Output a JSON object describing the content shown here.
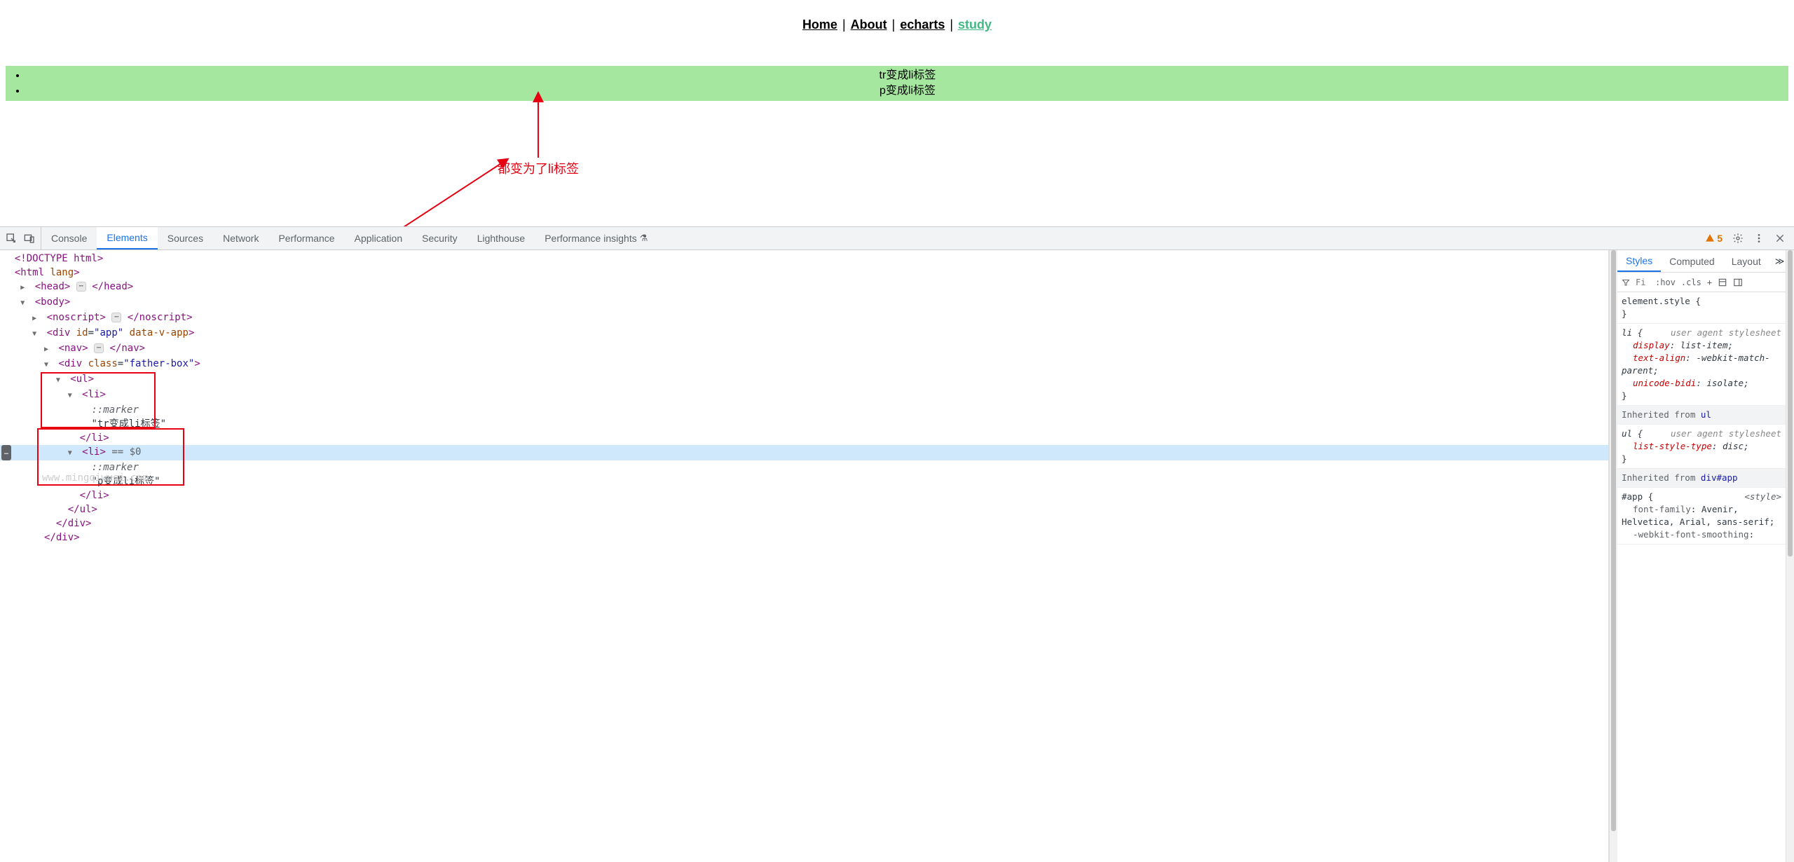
{
  "nav": {
    "items": [
      {
        "label": "Home",
        "active": false
      },
      {
        "label": "About",
        "active": false
      },
      {
        "label": "echarts",
        "active": false
      },
      {
        "label": "study",
        "active": true
      }
    ],
    "sep": " | "
  },
  "list": {
    "items": [
      "tr变成li标签",
      "p变成li标签"
    ]
  },
  "annotation": {
    "text": "都变为了li标签"
  },
  "devtools": {
    "tabs": [
      "Console",
      "Elements",
      "Sources",
      "Network",
      "Performance",
      "Application",
      "Security",
      "Lighthouse",
      "Performance insights"
    ],
    "active_tab": "Elements",
    "experiment_suffix_on": "Performance insights",
    "warn_count": "5",
    "elements": {
      "doctype": "<!DOCTYPE html>",
      "html_open": "<html lang>",
      "head": {
        "open": "<head>",
        "close": "</head>"
      },
      "body_open": "<body>",
      "noscript": {
        "open": "<noscript>",
        "close": "</noscript>"
      },
      "app_div": "<div id=\"app\" data-v-app>",
      "nav": {
        "open": "<nav>",
        "close": "</nav>"
      },
      "father_box": "<div class=\"father-box\">",
      "ul_open": "<ul>",
      "li1_open": "<li>",
      "li1_marker": "::marker",
      "li1_text": "\"tr变成li标签\"",
      "li1_close": "</li>",
      "li2_open": "<li>",
      "li2_selected": "== $0",
      "li2_marker": "::marker",
      "li2_text": "\"p变成li标签\"",
      "li2_close": "</li>",
      "ul_close": "</ul>",
      "div_close1": "</div>",
      "div_close2": "</div>",
      "selected_badge": "…"
    },
    "styles": {
      "tabs": [
        "Styles",
        "Computed",
        "Layout"
      ],
      "active_tab": "Styles",
      "toolbar": {
        "filter_placeholder": "Fi",
        "hov": ":hov",
        "cls": ".cls",
        "plus": "+"
      },
      "element_style": "element.style {",
      "brace_close": "}",
      "li_rule": {
        "selector": "li {",
        "comment": "user agent stylesheet",
        "props": [
          {
            "name": "display",
            "value": "list-item"
          },
          {
            "name": "text-align",
            "value": "-webkit-match-parent"
          },
          {
            "name": "unicode-bidi",
            "value": "isolate"
          }
        ]
      },
      "inherit_ul": {
        "label": "Inherited from ",
        "tag": "ul"
      },
      "ul_rule": {
        "selector": "ul {",
        "comment": "user agent stylesheet",
        "props": [
          {
            "name": "list-style-type",
            "value": "disc"
          }
        ]
      },
      "inherit_app": {
        "label": "Inherited from ",
        "tag": "div#app"
      },
      "app_rule": {
        "selector": "#app {",
        "source": "<style>",
        "props": [
          {
            "name": "font-family",
            "value": "Avenir, Helvetica, Arial, sans-serif"
          },
          {
            "name": "-webkit-font-smoothing",
            "value": ""
          }
        ]
      }
    }
  },
  "watermark": "www.mingqiwuqi.com"
}
